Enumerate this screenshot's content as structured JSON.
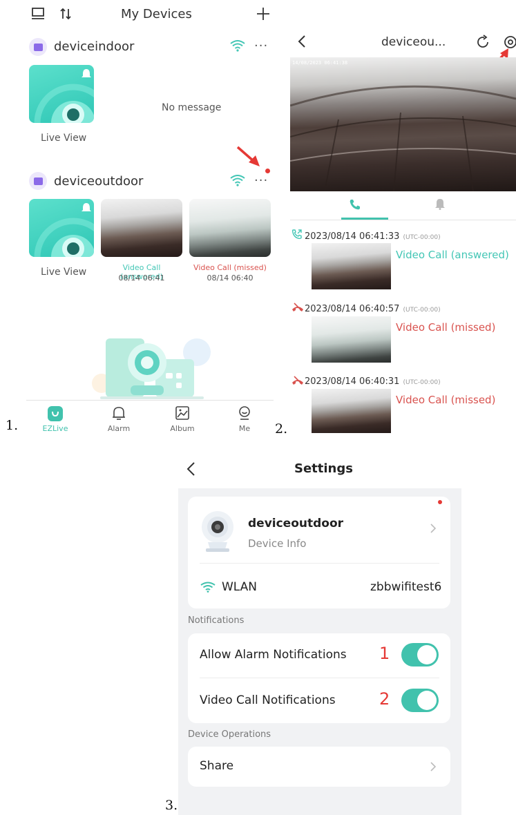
{
  "labels": {
    "p1": "1.",
    "p2": "2.",
    "p3": "3."
  },
  "panel1": {
    "title": "My Devices",
    "icons": {
      "monitor": "monitor-icon",
      "sort": "sort-icon",
      "add": "plus-icon"
    },
    "devices": [
      {
        "name": "deviceindoor",
        "message": "No message",
        "live_view": "Live View"
      },
      {
        "name": "deviceoutdoor",
        "live_view": "Live View",
        "events": [
          {
            "label": "Video Call (answered)",
            "time": "08/14 06:41",
            "status": "answered"
          },
          {
            "label": "Video Call (missed)",
            "time": "08/14 06:40",
            "status": "missed"
          }
        ]
      }
    ],
    "more_icon": "more-dots-icon",
    "tabs": [
      {
        "label": "EZLive",
        "icon": "home-icon",
        "active": true
      },
      {
        "label": "Alarm",
        "icon": "bell-icon",
        "active": false
      },
      {
        "label": "Album",
        "icon": "image-icon",
        "active": false
      },
      {
        "label": "Me",
        "icon": "user-icon",
        "active": false
      }
    ]
  },
  "panel2": {
    "title": "deviceou...",
    "overlay_timestamp": "14/08/2023 06:41:38",
    "logs": [
      {
        "time": "2023/08/14 06:41:33",
        "tz": "(UTC-00:00)",
        "label": "Video Call (answered)",
        "status": "answered"
      },
      {
        "time": "2023/08/14 06:40:57",
        "tz": "(UTC-00:00)",
        "label": "Video Call (missed)",
        "status": "missed"
      },
      {
        "time": "2023/08/14 06:40:31",
        "tz": "(UTC-00:00)",
        "label": "Video Call (missed)",
        "status": "missed"
      }
    ]
  },
  "panel3": {
    "title": "Settings",
    "device_name": "deviceoutdoor",
    "device_info": "Device Info",
    "wlan_label": "WLAN",
    "wlan_value": "zbbwifitest6",
    "notifications_header": "Notifications",
    "allow_alarm": "Allow Alarm Notifications",
    "allow_alarm_on": true,
    "video_call": "Video Call Notifications",
    "video_call_on": true,
    "marker1": "1",
    "marker2": "2",
    "device_ops_header": "Device Operations",
    "share": "Share"
  },
  "colors": {
    "accent": "#41c2ad",
    "missed": "#d9534f",
    "answered": "#43c6b5",
    "annotation_red": "#e53935"
  }
}
